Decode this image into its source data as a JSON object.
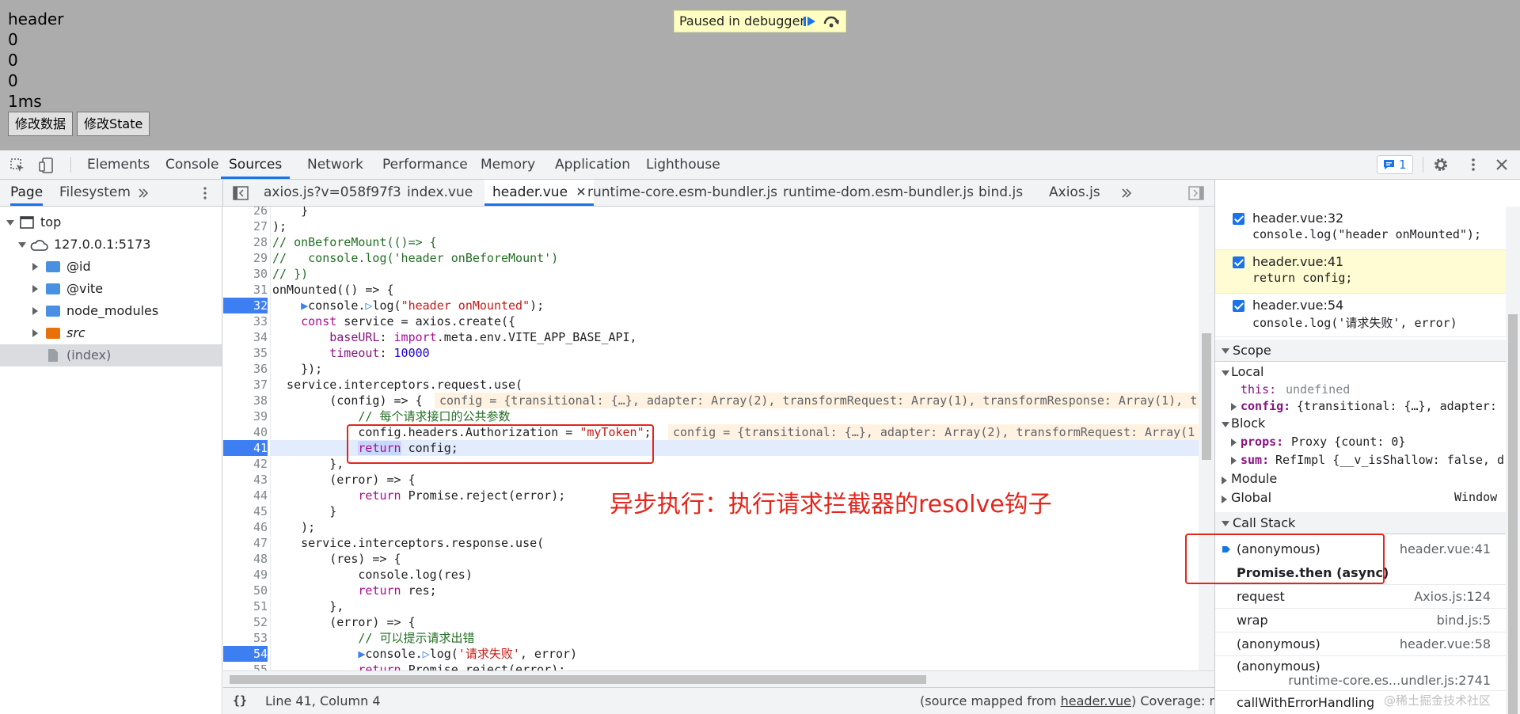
{
  "page": {
    "lines": [
      "header",
      "0",
      "0",
      "0",
      "1ms"
    ],
    "buttons": [
      "修改数据",
      "修改State"
    ],
    "paused_label": "Paused in debugger"
  },
  "devtools": {
    "tabs": [
      "Elements",
      "Console",
      "Sources",
      "Network",
      "Performance",
      "Memory",
      "Application",
      "Lighthouse"
    ],
    "active_tab": "Sources",
    "issues_count": "1",
    "navigator_tabs": [
      "Page",
      "Filesystem"
    ],
    "file_tabs": [
      "axios.js?v=058f97f3",
      "index.vue",
      "header.vue",
      "runtime-core.esm-bundler.js",
      "runtime-dom.esm-bundler.js",
      "bind.js",
      "Axios.js"
    ],
    "active_file": "header.vue"
  },
  "navigator": {
    "top": "top",
    "host": "127.0.0.1:5173",
    "items": [
      "@id",
      "@vite",
      "node_modules",
      "src",
      "(index)"
    ]
  },
  "editor": {
    "line_numbers": [
      "26",
      "27",
      "28",
      "29",
      "30",
      "31",
      "32",
      "33",
      "34",
      "35",
      "36",
      "37",
      "38",
      "39",
      "40",
      "41",
      "42",
      "43",
      "44",
      "45",
      "46",
      "47",
      "48",
      "49",
      "50",
      "51",
      "52",
      "53",
      "54",
      "55"
    ],
    "inline_values": {
      "line38": "config = {transitional: {…}, adapter: Array(2), transformRequest: Array(1), transformResponse: Array(1), t",
      "line40": "config = {transitional: {…}, adapter: Array(2), transformRequest: Array(1"
    },
    "annotation": "异步执行：执行请求拦截器的resolve钩子"
  },
  "status": {
    "position": "Line 41, Column 4",
    "source_mapped_prefix": "(source mapped from ",
    "source_mapped_file": "header.vue",
    "coverage": ")  Coverage: n/a"
  },
  "breakpoints": [
    {
      "file": "header.vue:32",
      "code": "console.log(\"header onMounted\");"
    },
    {
      "file": "header.vue:41",
      "code": "return config;"
    },
    {
      "file": "header.vue:54",
      "code": "console.log('请求失败', error)"
    }
  ],
  "scope": {
    "title": "Scope",
    "local": "Local",
    "this_key": "this:",
    "this_val": "undefined",
    "config_key": "config:",
    "config_val": "{transitional: {…}, adapter:",
    "block": "Block",
    "props_key": "props:",
    "props_val": "Proxy {count: 0}",
    "sum_key": "sum:",
    "sum_val": "RefImpl {__v_isShallow: false, d",
    "module": "Module",
    "global": "Global",
    "global_val": "Window"
  },
  "call_stack": {
    "title": "Call Stack",
    "frames": [
      {
        "name": "(anonymous)",
        "loc": "header.vue:41"
      },
      {
        "name": "Promise.then (async)",
        "loc": ""
      },
      {
        "name": "request",
        "loc": "Axios.js:124"
      },
      {
        "name": "wrap",
        "loc": "bind.js:5"
      },
      {
        "name": "(anonymous)",
        "loc": "header.vue:58"
      },
      {
        "name": "(anonymous)",
        "loc": "runtime-core.es...undler.js:2741"
      },
      {
        "name": "callWithErrorHandling",
        "loc": ""
      }
    ]
  },
  "watermark": "@稀土掘金技术社区",
  "colors": {
    "accent": "#1a73e8",
    "annotation": "#e3261d",
    "breakpoint": "#3d7ef3"
  }
}
